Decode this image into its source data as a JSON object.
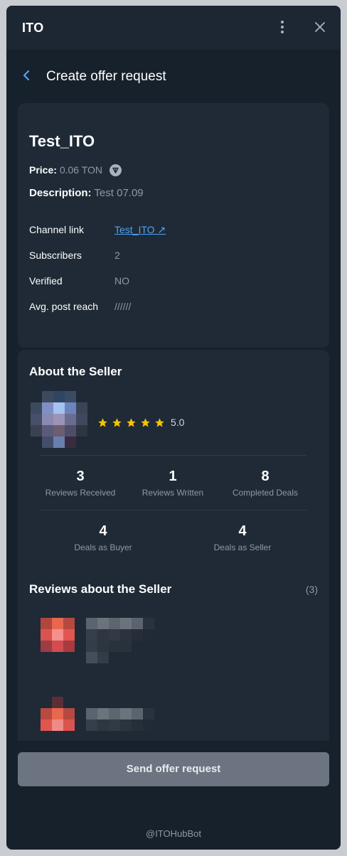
{
  "window": {
    "title": "ITO"
  },
  "header": {
    "title": "Create offer request"
  },
  "channel": {
    "name": "Test_ITO",
    "price_label": "Price:",
    "price_value": "0.06 TON",
    "description_label": "Description:",
    "description_value": "Test 07.09",
    "details": [
      {
        "key": "Channel link",
        "value": "Test_ITO ↗"
      },
      {
        "key": "Subscribers",
        "value": "2"
      },
      {
        "key": "Verified",
        "value": "NO"
      },
      {
        "key": "Avg. post reach",
        "value": "//////"
      }
    ]
  },
  "seller": {
    "title": "About the Seller",
    "rating": "5.0",
    "stars": 5,
    "stats_row1": [
      {
        "value": "3",
        "label": "Reviews Received"
      },
      {
        "value": "1",
        "label": "Reviews Written"
      },
      {
        "value": "8",
        "label": "Completed Deals"
      }
    ],
    "stats_row2": [
      {
        "value": "4",
        "label": "Deals as Buyer"
      },
      {
        "value": "4",
        "label": "Deals as Seller"
      }
    ]
  },
  "reviews": {
    "title": "Reviews about the Seller",
    "count": "(3)"
  },
  "actions": {
    "send_label": "Send offer request"
  },
  "footer": {
    "bot": "@ITOHubBot"
  },
  "colors": {
    "accent": "#4ea4f6",
    "star": "#f5c400",
    "background": "#17212b",
    "card": "#1f2a36",
    "button": "#6b7480"
  },
  "icons": [
    "menu-dots-icon",
    "close-icon",
    "back-chevron-icon",
    "ton-icon",
    "external-link-icon",
    "star-icon"
  ]
}
